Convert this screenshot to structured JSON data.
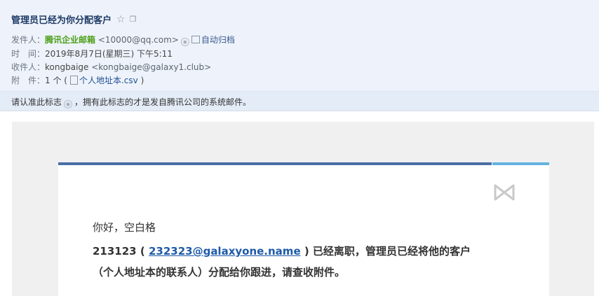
{
  "header": {
    "subject": "管理员已经为你分配客户",
    "star_icon": "star-icon",
    "window_icon": "new-window-icon",
    "from_label": "发件人：",
    "from_name": "腾讯企业邮箱",
    "from_address": "<10000@qq.com>",
    "archive_label": "自动归档",
    "time_label": "时　间：",
    "time_value": "2019年8月7日(星期三) 下午5:11",
    "to_label": "收件人：",
    "to_name": "kongbaige",
    "to_address": "<kongbaige@galaxy1.club>",
    "attach_label": "附　件：",
    "attach_count": "1 个",
    "attach_open": "(",
    "attach_file": "个人地址本.csv",
    "attach_close": ")"
  },
  "notice": {
    "text_before": "请认准此标志",
    "text_after": "，拥有此标志的才是发自腾讯公司的系统邮件。"
  },
  "body": {
    "greeting": "你好，空白格",
    "user_id": "213123",
    "open_paren": "(",
    "email": "232323@galaxyone.name",
    "line1_tail": ") 已经离职，管理员已经将他的客户",
    "line2": "（个人地址本的联系人）分配给你跟进，请查收附件。"
  },
  "colors": {
    "accent": "#4a6fa5",
    "accent_light": "#63b3e0",
    "sender": "#4c9f18",
    "header_bg": "#eef3fb"
  }
}
